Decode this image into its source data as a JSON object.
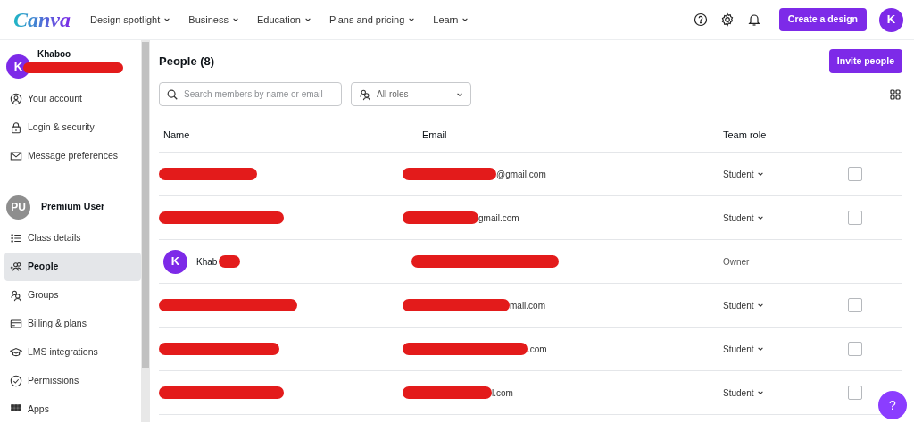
{
  "topnav": {
    "logo": "Canva",
    "menu": [
      {
        "label": "Design spotlight"
      },
      {
        "label": "Business"
      },
      {
        "label": "Education"
      },
      {
        "label": "Plans and pricing"
      },
      {
        "label": "Learn"
      }
    ],
    "create_button": "Create a design",
    "avatar": "K"
  },
  "sidebar": {
    "user": {
      "avatar": "K",
      "name": "Khaboo"
    },
    "account_items": [
      {
        "label": "Your account",
        "selected": false
      },
      {
        "label": "Login & security",
        "selected": false
      },
      {
        "label": "Message preferences",
        "selected": false
      }
    ],
    "team": {
      "avatar": "PU",
      "name": "Premium User"
    },
    "team_items": [
      {
        "label": "Class details",
        "selected": false
      },
      {
        "label": "People",
        "selected": true
      },
      {
        "label": "Groups",
        "selected": false
      },
      {
        "label": "Billing & plans",
        "selected": false
      },
      {
        "label": "LMS integrations",
        "selected": false
      },
      {
        "label": "Permissions",
        "selected": false
      },
      {
        "label": "Apps",
        "selected": false
      }
    ]
  },
  "main": {
    "title": "People (8)",
    "invite_button": "Invite people",
    "search": {
      "placeholder": "Search members by name or email"
    },
    "role_filter": "All roles",
    "table": {
      "columns": [
        "Name",
        "Email",
        "Team role"
      ],
      "rows": [
        {
          "kind": "member",
          "email": "@gmail.com",
          "role": "Student",
          "checked": false
        },
        {
          "kind": "member",
          "email": "gmail.com",
          "role": "Student",
          "checked": false
        },
        {
          "kind": "owner",
          "avatar": "K",
          "name": "Khab",
          "role": "Owner"
        },
        {
          "kind": "member",
          "email": "mail.com",
          "role": "Student",
          "checked": false
        },
        {
          "kind": "member",
          "email": ".com",
          "role": "Student",
          "checked": false
        },
        {
          "kind": "member",
          "email": "l.com",
          "role": "Student",
          "checked": false
        }
      ]
    }
  },
  "help_button": "?"
}
